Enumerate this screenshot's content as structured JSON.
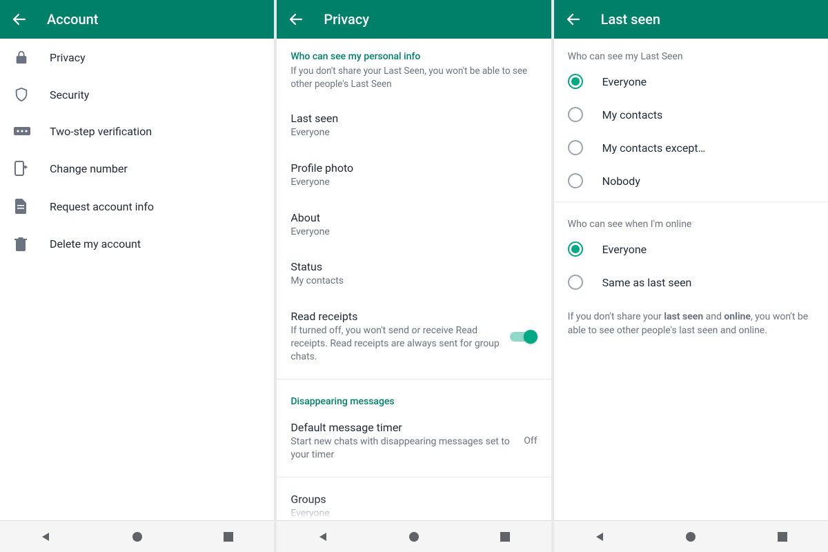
{
  "screens": [
    {
      "title": "Account",
      "items": [
        {
          "icon": "lock",
          "label": "Privacy"
        },
        {
          "icon": "shield",
          "label": "Security"
        },
        {
          "icon": "pin",
          "label": "Two-step verification"
        },
        {
          "icon": "sim",
          "label": "Change number"
        },
        {
          "icon": "doc",
          "label": "Request account info"
        },
        {
          "icon": "trash",
          "label": "Delete my account"
        }
      ]
    },
    {
      "title": "Privacy",
      "section1": {
        "header": "Who can see my personal info",
        "sub": "If you don't share your Last Seen, you won't be able to see other people's Last Seen"
      },
      "s1items": [
        {
          "title": "Last seen",
          "value": "Everyone"
        },
        {
          "title": "Profile photo",
          "value": "Everyone"
        },
        {
          "title": "About",
          "value": "Everyone"
        },
        {
          "title": "Status",
          "value": "My contacts"
        }
      ],
      "readreceipts": {
        "title": "Read receipts",
        "sub": "If turned off, you won't send or receive Read receipts. Read receipts are always sent for group chats."
      },
      "section2": {
        "header": "Disappearing messages"
      },
      "timer": {
        "title": "Default message timer",
        "sub": "Start new chats with disappearing messages set to your timer",
        "value": "Off"
      },
      "groups": {
        "title": "Groups",
        "value": "Everyone"
      }
    },
    {
      "title": "Last seen",
      "group1": {
        "header": "Who can see my Last Seen",
        "options": [
          "Everyone",
          "My contacts",
          "My contacts except…",
          "Nobody"
        ],
        "selected": 0
      },
      "group2": {
        "header": "Who can see when I'm online",
        "options": [
          "Everyone",
          "Same as last seen"
        ],
        "selected": 0
      },
      "footnote_pre": "If you don't share your ",
      "footnote_b1": "last seen",
      "footnote_mid": " and ",
      "footnote_b2": "online",
      "footnote_post": ", you won't be able to see other people's last seen and online."
    }
  ]
}
